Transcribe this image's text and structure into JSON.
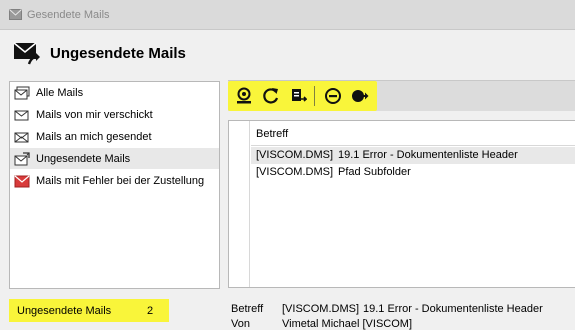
{
  "window": {
    "title": "Gesendete Mails"
  },
  "header": {
    "title": "Ungesendete Mails"
  },
  "sidebar": {
    "items": [
      {
        "label": "Alle Mails",
        "icon": "envelope-stack-icon"
      },
      {
        "label": "Mails von mir verschickt",
        "icon": "envelope-sent-icon"
      },
      {
        "label": "Mails an mich gesendet",
        "icon": "envelope-received-icon"
      },
      {
        "label": "Ungesendete Mails",
        "icon": "envelope-unsent-icon",
        "selected": true
      },
      {
        "label": "Mails mit Fehler bei der Zustellung",
        "icon": "envelope-error-icon",
        "color": "#d83a3a"
      }
    ]
  },
  "toolbar": {
    "buttons": [
      {
        "icon": "receive-icon"
      },
      {
        "icon": "refresh-icon"
      },
      {
        "icon": "export-icon"
      },
      {
        "icon": "delete-icon"
      },
      {
        "icon": "send-icon"
      }
    ],
    "highlight_color": "#f9f53a"
  },
  "maillist": {
    "columns": [
      "Betreff"
    ],
    "rows": [
      {
        "tag": "[VISCOM.DMS]",
        "subject": "19.1 Error - Dokumentenliste Header",
        "selected": true
      },
      {
        "tag": "[VISCOM.DMS]",
        "subject": "Pfad Subfolder",
        "selected": false
      }
    ]
  },
  "status": {
    "label": "Ungesendete Mails",
    "count": "2"
  },
  "detail": {
    "subject_label": "Betreff",
    "subject_tag": "[VISCOM.DMS]",
    "subject_value": "19.1 Error - Dokumentenliste Header",
    "from_label": "Von",
    "from_value": "Vimetal Michael [VISCOM]"
  }
}
